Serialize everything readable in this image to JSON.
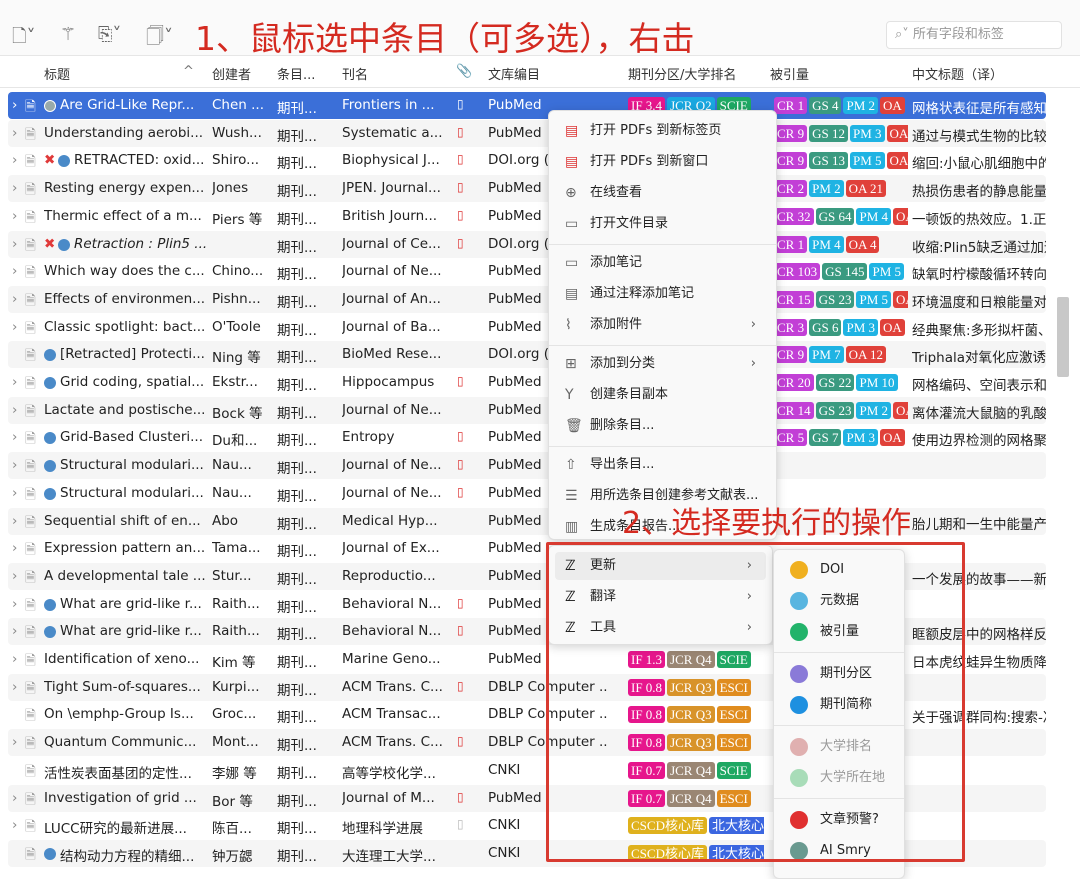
{
  "toolbar": {
    "icons": [
      "new-item-icon",
      "magic-wand-icon",
      "add-attachment-icon",
      "note-icon"
    ],
    "search_placeholder": "所有字段和标签"
  },
  "annotations": {
    "step1": "1、鼠标选中条目（可多选），右击",
    "step2": "2、选择要执行的操作"
  },
  "columns": [
    "标题",
    "创建者",
    "条目...",
    "刊名",
    "",
    "文库编目",
    "期刊分区/大学排名",
    "被引量",
    "中文标题（译）"
  ],
  "colors": {
    "selected": "#3b6fd8",
    "annotation": "#d42a20",
    "IF": "#e6168c",
    "JCR Q2": "#19a7e0",
    "JCR Q3": "#d8932a",
    "JCR Q4": "#9a8673",
    "SCIE": "#1ea863",
    "ESCI": "#e08c1e",
    "CR": "#c23fd6",
    "GS": "#3a9a80",
    "PM": "#1fb3e3",
    "OA": "#e0413a",
    "CSCD核心库": "#dfb11d",
    "北大核心": "#3b66e0"
  },
  "rows": [
    {
      "title": "Are Grid-Like Repr...",
      "creator": "Chen ...",
      "type": "期刊...",
      "journal": "Frontiers in ...",
      "lib": "PubMed",
      "dot": "gray",
      "rank": [
        "IF 3.4",
        "JCR Q2",
        "SCIE"
      ],
      "cited": [
        "CR 1",
        "GS 4",
        "PM 2",
        "OA"
      ],
      "zh": "网格状表征是所有感知",
      "expand": true,
      "pdf": "page"
    },
    {
      "title": "Understanding aerobi...",
      "creator": "Wush...",
      "type": "期刊...",
      "journal": "Systematic a...",
      "lib": "PubMed",
      "rank": [],
      "cited": [
        "CR 9",
        "GS 12",
        "PM 3",
        "OA"
      ],
      "zh": "通过与模式生物的比较",
      "expand": true,
      "pdf": "pdf"
    },
    {
      "title": "RETRACTED: oxid...",
      "creator": "Shiro...",
      "type": "期刊...",
      "journal": "Biophysical J...",
      "lib": "DOI.org (",
      "dot": "blue",
      "x": true,
      "rank": [],
      "cited": [
        "CR 9",
        "GS 13",
        "PM 5",
        "OA"
      ],
      "zh": "缩回:小鼠心肌细胞中的",
      "expand": true,
      "pdf": "pdf"
    },
    {
      "title": "Resting energy expen...",
      "creator": "Jones",
      "type": "期刊...",
      "journal": "JPEN. Journal...",
      "lib": "PubMed",
      "rank": [],
      "cited": [
        "CR 2",
        "PM 2",
        "OA 21"
      ],
      "zh": "热损伤患者的静息能量",
      "expand": true,
      "pdf": "pdf"
    },
    {
      "title": "Thermic effect of a m...",
      "creator": "Piers 等",
      "type": "期刊...",
      "journal": "British Journ...",
      "lib": "PubMed",
      "rank": [],
      "cited": [
        "CR 32",
        "GS 64",
        "PM 4",
        "OA"
      ],
      "zh": "一顿饭的热效应。1.正常",
      "expand": true,
      "pdf": "pdf"
    },
    {
      "title": "Retraction : Plin5 ...",
      "creator": "",
      "type": "期刊...",
      "journal": "Journal of Ce...",
      "lib": "DOI.org (",
      "dot": "blue",
      "x": true,
      "italic": true,
      "rank": [],
      "cited": [
        "CR 1",
        "PM 4",
        "OA 4"
      ],
      "zh": "收缩:Plin5缺乏通过加速",
      "expand": true,
      "pdf": "pdf"
    },
    {
      "title": "Which way does the c...",
      "creator": "Chino...",
      "type": "期刊...",
      "journal": "Journal of Ne...",
      "lib": "PubMed",
      "rank": [],
      "cited": [
        "CR 103",
        "GS 145",
        "PM 5"
      ],
      "zh": "缺氧时柠檬酸循环转向",
      "expand": true
    },
    {
      "title": "Effects of environmen...",
      "creator": "Pishn...",
      "type": "期刊...",
      "journal": "Journal of An...",
      "lib": "PubMed",
      "rank": [],
      "cited": [
        "CR 15",
        "GS 23",
        "PM 5",
        "OA"
      ],
      "zh": "环境温度和日粮能量对",
      "expand": true
    },
    {
      "title": "Classic spotlight: bact...",
      "creator": "O'Toole",
      "type": "期刊...",
      "journal": "Journal of Ba...",
      "lib": "PubMed",
      "rank": [],
      "cited": [
        "CR 3",
        "GS 6",
        "PM 3",
        "OA"
      ],
      "zh": "经典聚焦:多形拟杆菌、",
      "expand": true
    },
    {
      "title": "[Retracted] Protecti...",
      "creator": "Ning 等",
      "type": "期刊...",
      "journal": "BioMed Rese...",
      "lib": "DOI.org (",
      "dot": "blue",
      "rank": [],
      "cited": [
        "CR 9",
        "PM 7",
        "OA 12"
      ],
      "zh": "Triphala对氧化应激诱导",
      "expand": false
    },
    {
      "title": "Grid coding, spatial...",
      "creator": "Ekstr...",
      "type": "期刊...",
      "journal": "Hippocampus",
      "lib": "PubMed",
      "dot": "blue",
      "rank": [],
      "cited": [
        "CR 20",
        "GS 22",
        "PM 10"
      ],
      "zh": "网格编码、空间表示和",
      "expand": true,
      "pdf": "pdf"
    },
    {
      "title": "Lactate and postische...",
      "creator": "Bock 等",
      "type": "期刊...",
      "journal": "Journal of Ne...",
      "lib": "PubMed",
      "rank": [],
      "cited": [
        "CR 14",
        "GS 23",
        "PM 2",
        "OA"
      ],
      "zh": "离体灌流大鼠脑的乳酸",
      "expand": true
    },
    {
      "title": "Grid-Based Clusteri...",
      "creator": "Du和...",
      "type": "期刊...",
      "journal": "Entropy",
      "lib": "PubMed",
      "dot": "blue",
      "rank": [],
      "cited": [
        "CR 5",
        "GS 7",
        "PM 3",
        "OA"
      ],
      "zh": "使用边界检测的网格聚",
      "expand": true,
      "pdf": "pdf"
    },
    {
      "title": "Structural modulari...",
      "creator": "Nau...",
      "type": "期刊...",
      "journal": "Journal of Ne...",
      "lib": "PubMed",
      "dot": "blue",
      "rank": [],
      "cited": [],
      "zh": "",
      "expand": true,
      "pdf": "pdf"
    },
    {
      "title": "Structural modulari...",
      "creator": "Nau...",
      "type": "期刊...",
      "journal": "Journal of Ne...",
      "lib": "PubMed",
      "dot": "blue",
      "rank": [],
      "cited": [],
      "zh": "",
      "expand": true,
      "pdf": "pdf"
    },
    {
      "title": "Sequential shift of en...",
      "creator": "Abo",
      "type": "期刊...",
      "journal": "Medical Hyp...",
      "lib": "PubMed",
      "rank": [],
      "cited": [],
      "zh": "胎儿期和一生中能量产",
      "expand": true
    },
    {
      "title": "Expression pattern an...",
      "creator": "Tama...",
      "type": "期刊...",
      "journal": "Journal of Ex...",
      "lib": "PubMed",
      "rank": [],
      "cited": [],
      "zh": "",
      "expand": true
    },
    {
      "title": "A developmental tale ...",
      "creator": "Stur...",
      "type": "期刊...",
      "journal": "Reproductio...",
      "lib": "PubMed",
      "rank": [],
      "cited": [],
      "zh": "一个发展的故事——新",
      "expand": true
    },
    {
      "title": "What are grid-like r...",
      "creator": "Raith...",
      "type": "期刊...",
      "journal": "Behavioral N...",
      "lib": "PubMed",
      "dot": "blue",
      "rank": [],
      "cited": [],
      "zh": "",
      "expand": true,
      "pdf": "pdf"
    },
    {
      "title": "What are grid-like r...",
      "creator": "Raith...",
      "type": "期刊...",
      "journal": "Behavioral N...",
      "lib": "PubMed",
      "dot": "blue",
      "rank": [],
      "cited": [],
      "zh": "眶额皮层中的网格样反",
      "expand": true,
      "pdf": "pdf"
    },
    {
      "title": "Identification of xeno...",
      "creator": "Kim 等",
      "type": "期刊...",
      "journal": "Marine Geno...",
      "lib": "PubMed",
      "rank": [
        "IF 1.3",
        "JCR Q4",
        "SCIE"
      ],
      "cited": [],
      "zh": "日本虎纹蛙异生物质降",
      "expand": true
    },
    {
      "title": "Tight Sum-of-squares...",
      "creator": "Kurpi...",
      "type": "期刊...",
      "journal": "ACM Trans. C...",
      "lib": "DBLP Computer ...",
      "rank": [
        "IF 0.8",
        "JCR Q3",
        "ESCI"
      ],
      "cited": [],
      "zh": "",
      "expand": true,
      "pdf": "pdf"
    },
    {
      "title": "On \\emphp-Group Is...",
      "creator": "Groc...",
      "type": "期刊...",
      "journal": "ACM Transac...",
      "lib": "DBLP Computer ...",
      "rank": [
        "IF 0.8",
        "JCR Q3",
        "ESCI"
      ],
      "cited": [],
      "zh": "关于强调群同构:搜索-决",
      "expand": false
    },
    {
      "title": "Quantum Communic...",
      "creator": "Mont...",
      "type": "期刊...",
      "journal": "ACM Trans. C...",
      "lib": "DBLP Computer ...",
      "rank": [
        "IF 0.8",
        "JCR Q3",
        "ESCI"
      ],
      "cited": [],
      "zh": "",
      "expand": true,
      "pdf": "pdf"
    },
    {
      "title": "活性炭表面基团的定性...",
      "creator": "李娜 等",
      "type": "期刊...",
      "journal": "高等学校化学...",
      "lib": "CNKI",
      "rank": [
        "IF 0.7",
        "JCR Q4",
        "SCIE"
      ],
      "cited": [],
      "zh": "",
      "expand": false
    },
    {
      "title": "Investigation of grid ...",
      "creator": "Bor 等",
      "type": "期刊...",
      "journal": "Journal of M...",
      "lib": "PubMed",
      "rank": [
        "IF 0.7",
        "JCR Q4",
        "ESCI"
      ],
      "cited": [],
      "zh": "",
      "expand": true,
      "pdf": "pdf"
    },
    {
      "title": "LUCC研究的最新进展...",
      "creator": "陈百...",
      "type": "期刊...",
      "journal": "地理科学进展",
      "lib": "CNKI",
      "rank": [
        "CSCD核心库",
        "北大核心"
      ],
      "cited": [],
      "zh": "",
      "expand": true,
      "pdf": "file"
    },
    {
      "title": "结构动力方程的精细...",
      "creator": "钟万勰",
      "type": "期刊...",
      "journal": "大连理工大学...",
      "lib": "CNKI",
      "dot": "blue",
      "rank": [
        "CSCD核心库",
        "北大核心"
      ],
      "cited": [],
      "zh": "",
      "expand": false
    }
  ],
  "context_menu": {
    "items": [
      {
        "label": "打开 PDFs 到新标签页",
        "icon": "pdf-icon"
      },
      {
        "label": "打开 PDFs 到新窗口",
        "icon": "pdf-icon"
      },
      {
        "label": "在线查看",
        "icon": "globe-icon"
      },
      {
        "label": "打开文件目录",
        "icon": "folder-icon",
        "sep_after": true
      },
      {
        "label": "添加笔记",
        "icon": "note-icon"
      },
      {
        "label": "通过注释添加笔记",
        "icon": "annotation-note-icon"
      },
      {
        "label": "添加附件",
        "icon": "paperclip-icon",
        "submenu": true,
        "sep_after": true
      },
      {
        "label": "添加到分类",
        "icon": "add-collection-icon",
        "submenu": true
      },
      {
        "label": "创建条目副本",
        "icon": "duplicate-icon"
      },
      {
        "label": "删除条目...",
        "icon": "trash-icon",
        "sep_after": true
      },
      {
        "label": "导出条目...",
        "icon": "export-icon"
      },
      {
        "label": "用所选条目创建参考文献表...",
        "icon": "bibliography-icon"
      },
      {
        "label": "生成条目报告...",
        "icon": "report-icon"
      }
    ]
  },
  "plugin_menu": {
    "items": [
      {
        "label": "更新"
      },
      {
        "label": "翻译"
      },
      {
        "label": "工具"
      }
    ]
  },
  "update_submenu": {
    "groups": [
      [
        {
          "label": "DOI",
          "icon": "doi-icon",
          "color": "#f0b020"
        },
        {
          "label": "元数据",
          "icon": "metadata-icon",
          "color": "#58b5e0"
        },
        {
          "label": "被引量",
          "icon": "citation-icon",
          "color": "#22b36a"
        }
      ],
      [
        {
          "label": "期刊分区",
          "icon": "medal-icon",
          "color": "#8a7ad8"
        },
        {
          "label": "期刊简称",
          "icon": "abbr-icon",
          "color": "#1e90e0"
        }
      ],
      [
        {
          "label": "大学排名",
          "icon": "university-icon",
          "color": "#e0b0b0",
          "disabled": true
        },
        {
          "label": "大学所在地",
          "icon": "location-icon",
          "color": "#a8dcb8",
          "disabled": true
        }
      ],
      [
        {
          "label": "文章预警?",
          "icon": "alarm-icon",
          "color": "#e03030"
        },
        {
          "label": "AI Smry",
          "icon": "ai-icon",
          "color": "#6a9a90"
        }
      ]
    ]
  }
}
